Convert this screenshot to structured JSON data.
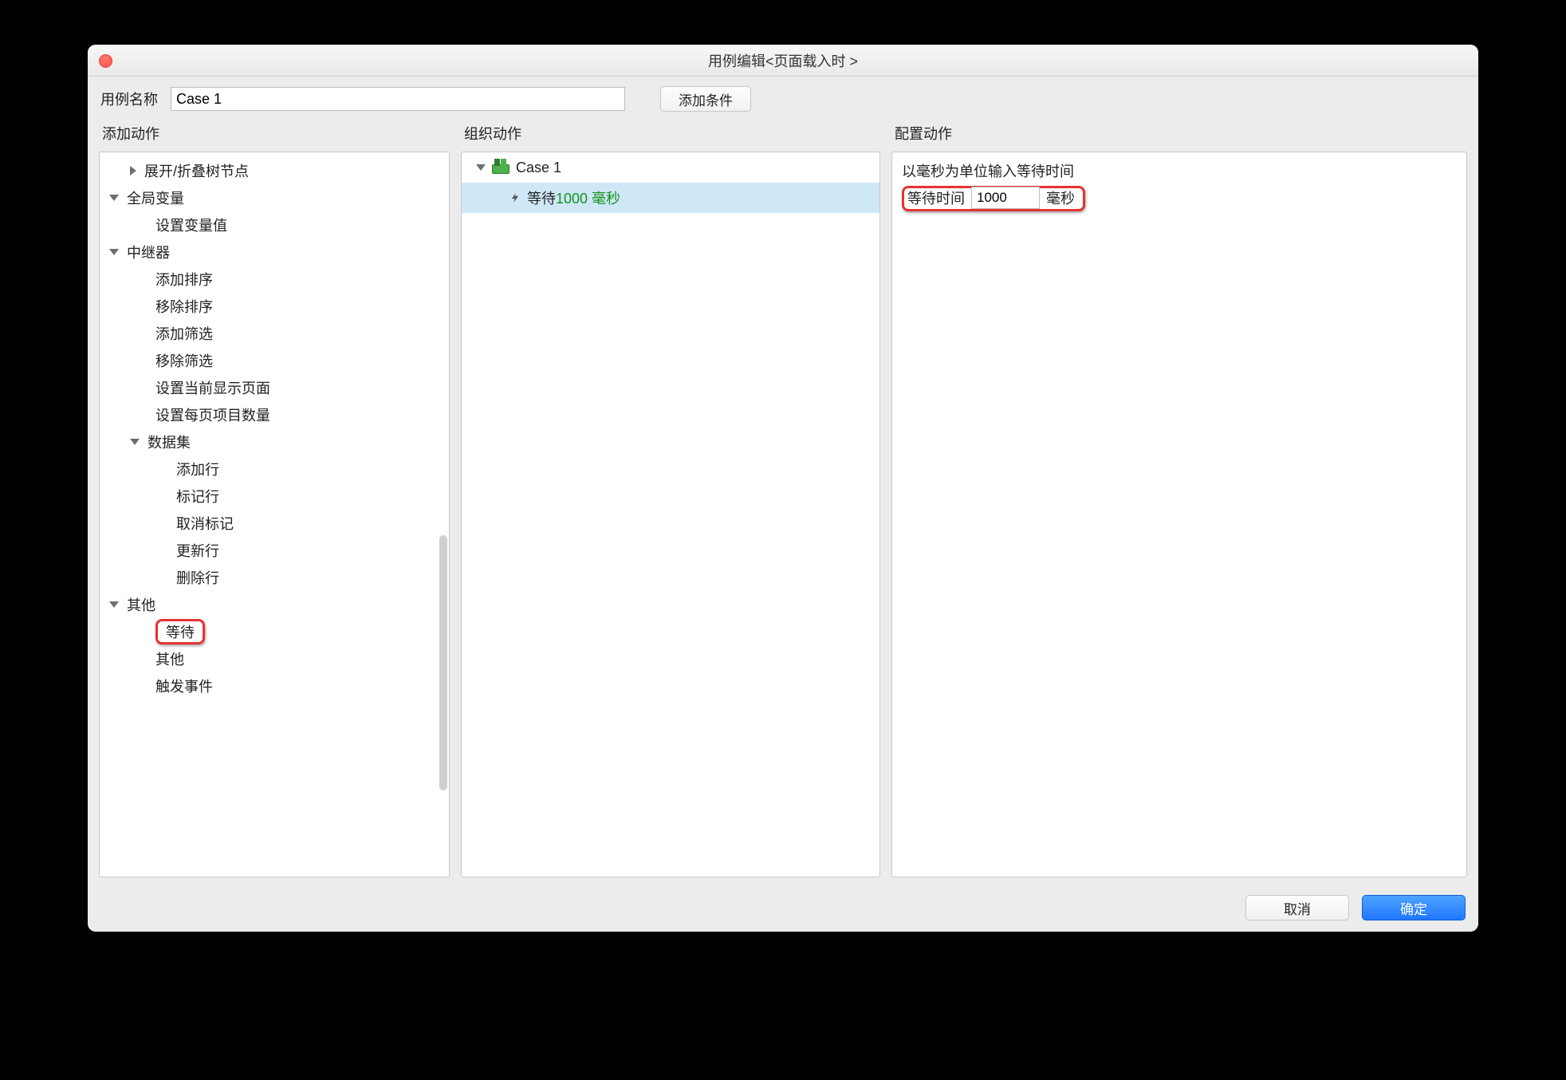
{
  "window": {
    "title": "用例编辑<页面载入时 >"
  },
  "header": {
    "case_name_label": "用例名称",
    "case_name_value": "Case 1",
    "add_condition": "添加条件"
  },
  "left": {
    "title": "添加动作",
    "tree": {
      "expand_collapse": "展开/折叠树节点",
      "global_vars": "全局变量",
      "set_var": "设置变量值",
      "repeater": "中继器",
      "add_sort": "添加排序",
      "remove_sort": "移除排序",
      "add_filter": "添加筛选",
      "remove_filter": "移除筛选",
      "set_current_page": "设置当前显示页面",
      "set_items_per_page": "设置每页项目数量",
      "dataset": "数据集",
      "add_row": "添加行",
      "mark_row": "标记行",
      "unmark_row": "取消标记",
      "update_row": "更新行",
      "delete_row": "删除行",
      "other": "其他",
      "wait": "等待",
      "other2": "其他",
      "fire_event": "触发事件"
    }
  },
  "mid": {
    "title": "组织动作",
    "case_label": "Case 1",
    "action_prefix": "等待 ",
    "action_value": "1000 毫秒"
  },
  "right": {
    "title": "配置动作",
    "hint": "以毫秒为单位输入等待时间",
    "wait_label": "等待时间",
    "wait_value": "1000",
    "wait_unit": "毫秒"
  },
  "footer": {
    "cancel": "取消",
    "ok": "确定"
  }
}
